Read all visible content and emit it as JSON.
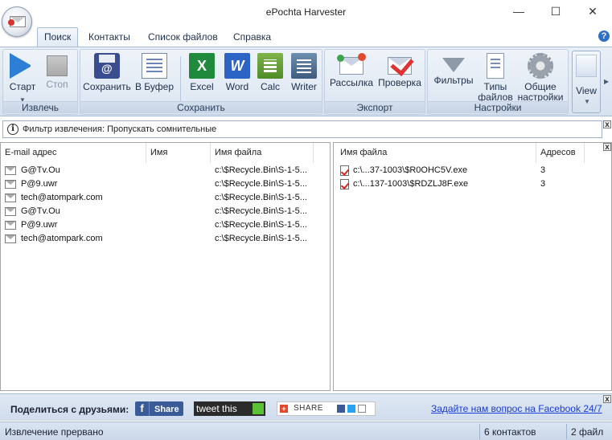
{
  "window": {
    "title": "ePochta Harvester",
    "min": "—",
    "max": "☐",
    "close": "✕"
  },
  "tabs": [
    {
      "label": "Поиск",
      "active": true
    },
    {
      "label": "Контакты"
    },
    {
      "label": "Список файлов"
    },
    {
      "label": "Справка"
    }
  ],
  "help": "?",
  "ribbon": {
    "groups": {
      "extract": "Извлечь",
      "save": "Сохранить",
      "export": "Экспорт",
      "settings": "Настройки"
    },
    "buttons": {
      "start": "Старт",
      "stop": "Стоп",
      "save": "Сохранить",
      "clipboard": "В Буфер",
      "excel": "Excel",
      "word": "Word",
      "calc": "Calc",
      "writer": "Writer",
      "mailing": "Рассылка",
      "check": "Проверка",
      "filters": "Фильтры",
      "filetypes_1": "Типы",
      "filetypes_2": "файлов",
      "general_1": "Общие",
      "general_2": "настройки",
      "view": "View"
    },
    "icons": {
      "word_glyph": "W",
      "excel_glyph": "X"
    }
  },
  "filter_bar": {
    "info_glyph": "i",
    "text": "Фильтр извлечения: Пропускать сомнительные",
    "close": "x"
  },
  "emails_table": {
    "headers": [
      "E-mail адрес",
      "Имя",
      "Имя файла"
    ],
    "rows": [
      {
        "email": "G@Tv.Ou",
        "name": "",
        "file": "c:\\$Recycle.Bin\\S-1-5..."
      },
      {
        "email": "P@9.uwr",
        "name": "",
        "file": "c:\\$Recycle.Bin\\S-1-5..."
      },
      {
        "email": "tech@atompark.com",
        "name": "",
        "file": "c:\\$Recycle.Bin\\S-1-5..."
      },
      {
        "email": "G@Tv.Ou",
        "name": "",
        "file": "c:\\$Recycle.Bin\\S-1-5..."
      },
      {
        "email": "P@9.uwr",
        "name": "",
        "file": "c:\\$Recycle.Bin\\S-1-5..."
      },
      {
        "email": "tech@atompark.com",
        "name": "",
        "file": "c:\\$Recycle.Bin\\S-1-5..."
      }
    ]
  },
  "files_table": {
    "headers": [
      "Имя файла",
      "Адресов"
    ],
    "close": "x",
    "rows": [
      {
        "file": "c:\\...37-1003\\$R0OHC5V.exe",
        "count": "3"
      },
      {
        "file": "c:\\...137-1003\\$RDZLJ8F.exe",
        "count": "3"
      }
    ]
  },
  "share": {
    "label": "Поделиться с друзьями:",
    "fb_glyph": "f",
    "fb_label": "Share",
    "tweet_label": "tweet this",
    "addthis_label": "SHARE",
    "facebook_link": "Задайте нам вопрос на Facebook 24/7",
    "close": "x"
  },
  "status": {
    "message": "Извлечение прервано",
    "contacts": "6 контактов",
    "files": "2 файл"
  },
  "colors": {
    "accent": "#2d7fd6",
    "ribbon": "#d7e2ef",
    "link": "#1a3bd6"
  }
}
